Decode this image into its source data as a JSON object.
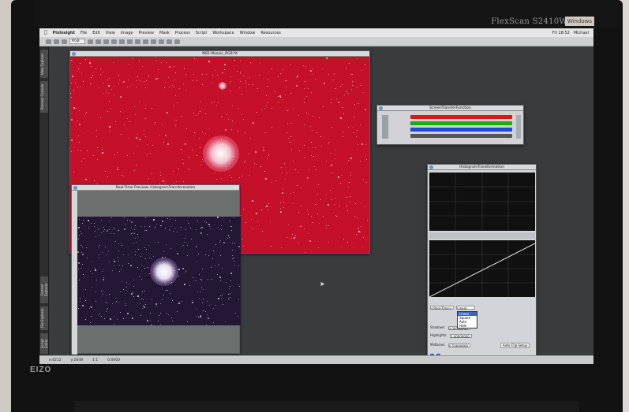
{
  "monitor": {
    "brand": "FlexScan S2410W",
    "badge": "Windows",
    "logo": "EIZO"
  },
  "menubar": {
    "app": "PixInsight",
    "items": [
      "File",
      "Edit",
      "View",
      "Image",
      "Preview",
      "Mask",
      "Process",
      "Script",
      "Workspace",
      "Window",
      "Resources"
    ],
    "clock": "Fri 18:52",
    "user": "Michael"
  },
  "toolbar": {
    "select_value": "RGB"
  },
  "side_tabs": [
    "View Explorer",
    "Process Console",
    "Format Explorer",
    "File Explorer",
    "Script Editor"
  ],
  "windows": {
    "main_title": "M81 Mosaic_RGB.fit",
    "preview_title": "Real-Time Preview: HistogramTransformation",
    "stf_title": "ScreenTransferFunction",
    "ht_title": "HistogramTransformation"
  },
  "histogram": {
    "view_select": "<Real-Time>",
    "channel_select": "Linear",
    "rows": [
      {
        "label": "Shadows:",
        "value": "0.00000000"
      },
      {
        "label": "Highlights:",
        "value": "1.00000000"
      },
      {
        "label": "Midtones:",
        "value": "0.50000000"
      }
    ],
    "dropdown_options": [
      "Linear",
      "Square",
      "Auto",
      "Hide"
    ],
    "auto_button": "Auto Clip Setup"
  },
  "status": {
    "coords": "x:4212",
    "y": "y:2648",
    "zoom": "1:1",
    "value": "0.0000"
  },
  "colors": {
    "main_image": "#c5102a",
    "preview_bg": "#231734",
    "stf_red": "#d11a1a",
    "stf_green": "#13b113",
    "stf_blue": "#1d4bd8"
  }
}
